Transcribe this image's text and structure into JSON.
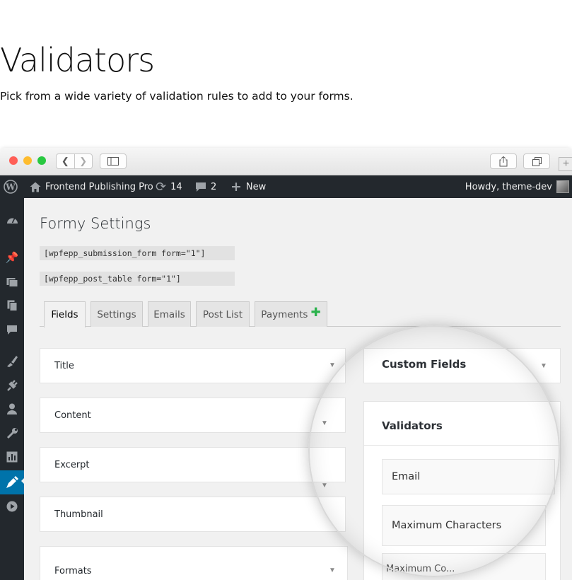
{
  "hero": {
    "title": "Validators",
    "subtitle": "Pick from a wide variety of validation rules to add to your forms."
  },
  "browser": {
    "back_icon": "chevron-left-icon",
    "forward_icon": "chevron-right-icon",
    "sidebar_icon": "sidebar-icon",
    "share_icon": "share-icon",
    "tabs_icon": "tabs-icon",
    "new_tab_label": "+"
  },
  "admin_bar": {
    "site_name": "Frontend Publishing Pro",
    "updates_count": "14",
    "comments_count": "2",
    "new_label": "New",
    "howdy": "Howdy, theme-dev"
  },
  "admin_menu": {
    "icons": [
      "dashboard-icon",
      "pin-icon",
      "media-icon",
      "pages-icon",
      "comments-icon",
      "appearance-icon",
      "plugins-icon",
      "users-icon",
      "tools-icon",
      "settings-icon",
      "formy-icon",
      "play-icon"
    ]
  },
  "page": {
    "title": "Formy Settings",
    "shortcode_submission": "[wpfepp_submission_form form=\"1\"]",
    "shortcode_table": "[wpfepp_post_table form=\"1\"]"
  },
  "tabs": [
    {
      "label": "Fields"
    },
    {
      "label": "Settings"
    },
    {
      "label": "Emails"
    },
    {
      "label": "Post List"
    },
    {
      "label": "Payments"
    }
  ],
  "fields": [
    {
      "label": "Title"
    },
    {
      "label": "Content"
    },
    {
      "label": "Excerpt"
    },
    {
      "label": "Thumbnail"
    },
    {
      "label": "Formats"
    }
  ],
  "custom_fields": {
    "title": "Custom Fields"
  },
  "validators": {
    "title": "Validators",
    "items": [
      {
        "label": "Email"
      },
      {
        "label": "Maximum Characters"
      },
      {
        "label": "Maximum Co..."
      }
    ]
  },
  "colors": {
    "admin_bar": "#23282d",
    "active_menu": "#0073aa",
    "payments_plus": "#2bb24c"
  }
}
